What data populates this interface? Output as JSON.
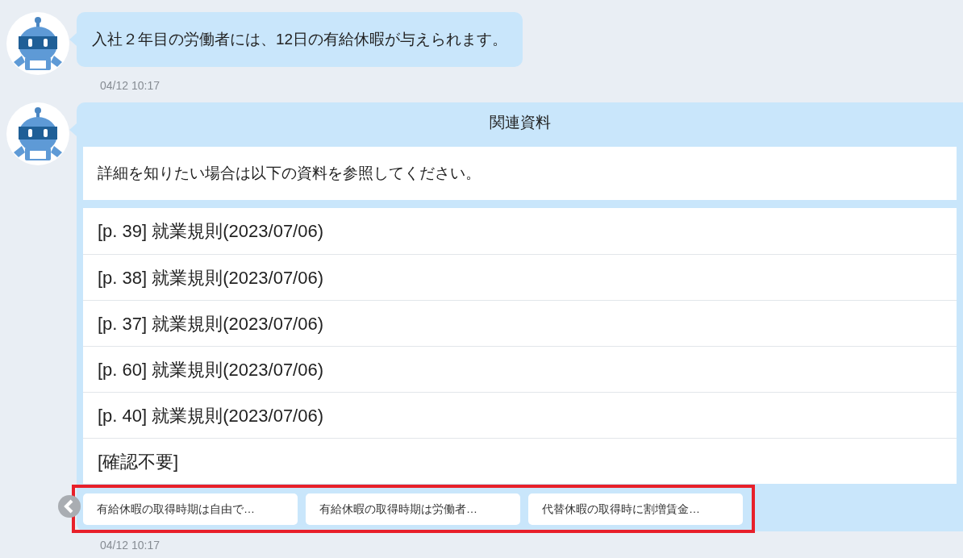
{
  "messages": [
    {
      "kind": "text",
      "text": "入社２年目の労働者には、12日の有給休暇が与えられます。",
      "time": "04/12 10:17"
    },
    {
      "kind": "references",
      "title": "関連資料",
      "intro": "詳細を知りたい場合は以下の資料を参照してください。",
      "items": [
        "[p. 39] 就業規則(2023/07/06)",
        "[p. 38] 就業規則(2023/07/06)",
        "[p. 37] 就業規則(2023/07/06)",
        "[p. 60] 就業規則(2023/07/06)",
        "[p. 40] 就業規則(2023/07/06)",
        "[確認不要]"
      ],
      "suggestions": [
        "有給休暇の取得時期は自由で…",
        "有給休暇の取得時期は労働者…",
        "代替休暇の取得時に割増賃金…"
      ],
      "highlighted": true,
      "time": "04/12 10:17"
    }
  ]
}
